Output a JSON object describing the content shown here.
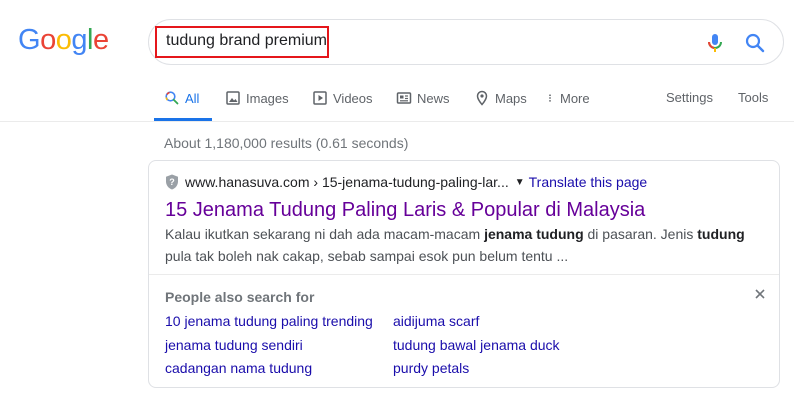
{
  "logo": {
    "letters": [
      "G",
      "o",
      "o",
      "g",
      "l",
      "e"
    ],
    "colors": [
      "#4285f4",
      "#ea4335",
      "#fbbc05",
      "#4285f4",
      "#34a853",
      "#ea4335"
    ],
    "icon": "google-logo"
  },
  "search": {
    "query": "tudung brand premium",
    "highlight_color": "#e5161b",
    "mic_icon": "mic-icon",
    "search_icon": "search-icon"
  },
  "tabs": [
    {
      "label": "All",
      "icon": "search-icon",
      "active": true
    },
    {
      "label": "Images",
      "icon": "image-icon"
    },
    {
      "label": "Videos",
      "icon": "video-icon"
    },
    {
      "label": "News",
      "icon": "news-icon"
    },
    {
      "label": "Maps",
      "icon": "map-pin-icon"
    },
    {
      "label": "More",
      "icon": "more-vert-icon"
    }
  ],
  "tools": {
    "settings": "Settings",
    "tools": "Tools"
  },
  "stats": "About 1,180,000 results (0.61 seconds)",
  "result": {
    "url": "www.hanasuva.com › 15-jenama-tudung-paling-lar...",
    "translate": "Translate this page",
    "title": "15 Jenama Tudung Paling Laris & Popular di Malaysia",
    "snippet_parts": {
      "p1": "Kalau ikutkan sekarang ni dah ada macam-macam ",
      "b1": "jenama tudung",
      "p2": " di pasaran. Jenis ",
      "b2": "tudung",
      "p3": " pula tak boleh nak cakap, sebab sampai esok pun belum tentu ..."
    }
  },
  "people_also_search": {
    "title": "People also search for",
    "items": [
      "10 jenama tudung paling trending",
      "aidijuma scarf",
      "jenama tudung sendiri",
      "tudung bawal jenama duck",
      "cadangan nama tudung",
      "purdy petals"
    ]
  },
  "colors": {
    "link": "#1a0dab",
    "visited": "#660099",
    "active_tab": "#1a73e8",
    "muted": "#70757a"
  }
}
